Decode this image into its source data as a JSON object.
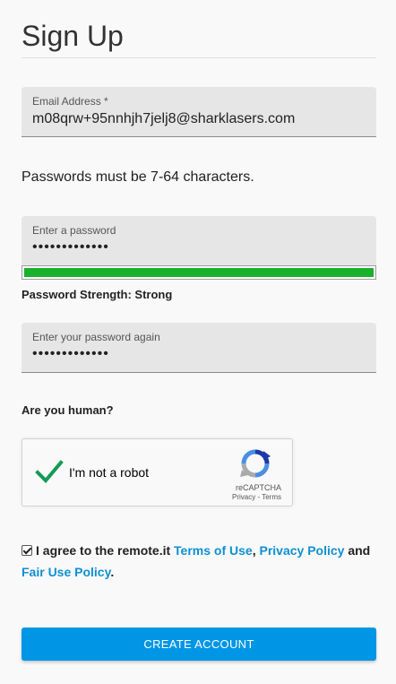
{
  "page": {
    "title": "Sign Up"
  },
  "email": {
    "label": "Email Address *",
    "value": "m08qrw+95nnhjh7jelj8@sharklasers.com"
  },
  "password_hint": "Passwords must be 7-64 characters.",
  "password": {
    "label": "Enter a password",
    "masked": "•••••••••••••"
  },
  "strength": {
    "label": "Password Strength: Strong",
    "fraction": 1.0,
    "color": "#19b02d"
  },
  "confirm": {
    "label": "Enter your password again",
    "masked": "•••••••••••••"
  },
  "captcha": {
    "question": "Are you human?",
    "checkbox_label": "I'm not a robot",
    "brand": "reCAPTCHA",
    "privacy": "Privacy",
    "separator": " - ",
    "terms": "Terms",
    "checked": true
  },
  "agreement": {
    "prefix": "I agree to the remote.it ",
    "terms_link": "Terms of Use",
    "comma": ", ",
    "privacy_link": "Privacy Policy",
    "and": " and ",
    "fair_use_link": "Fair Use Policy",
    "period": ".",
    "checked": true
  },
  "submit": {
    "label": "CREATE ACCOUNT"
  },
  "colors": {
    "accent": "#0096e6",
    "link": "#0e90d2",
    "success": "#19b02d"
  },
  "icons": {
    "checkmark": "checkmark-icon",
    "recaptcha": "recaptcha-logo-icon",
    "agree": "checkbox-checked-icon"
  }
}
